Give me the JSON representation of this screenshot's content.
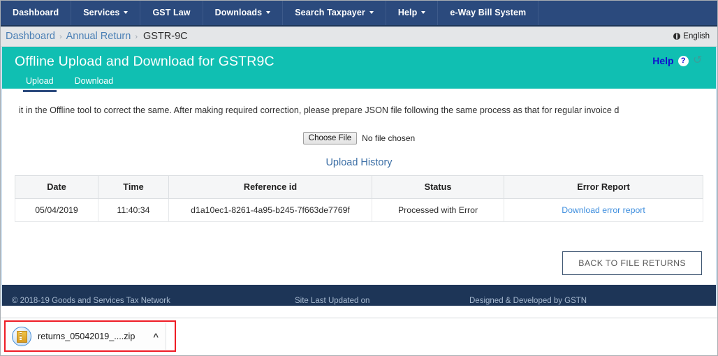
{
  "navbar": {
    "items": [
      {
        "label": "Dashboard",
        "has_caret": false
      },
      {
        "label": "Services",
        "has_caret": true
      },
      {
        "label": "GST Law",
        "has_caret": false
      },
      {
        "label": "Downloads",
        "has_caret": true
      },
      {
        "label": "Search Taxpayer",
        "has_caret": true
      },
      {
        "label": "Help",
        "has_caret": true
      },
      {
        "label": "e-Way Bill System",
        "has_caret": false
      }
    ]
  },
  "breadcrumb": {
    "items": [
      "Dashboard",
      "Annual Return",
      "GSTR-9C"
    ],
    "separator": "›",
    "language": "English",
    "language_icon": "globe-icon"
  },
  "page_header": {
    "title": "Offline Upload and Download for GSTR9C",
    "help_label": "Help",
    "help_badge": "?",
    "refresh_icon": "refresh-icon",
    "tabs": [
      {
        "label": "Upload",
        "active": true
      },
      {
        "label": "Download",
        "active": false
      }
    ]
  },
  "content": {
    "note": "it in the Offline tool to correct the same. After making required correction, please prepare JSON file following the same process as that for regular invoice d",
    "choose_file_label": "Choose File",
    "no_file_label": "No file chosen",
    "upload_history_title": "Upload History"
  },
  "history_table": {
    "headers": [
      "Date",
      "Time",
      "Reference id",
      "Status",
      "Error Report"
    ],
    "rows": [
      {
        "date": "05/04/2019",
        "time": "11:40:34",
        "reference_id": "d1a10ec1-8261-4a95-b245-7f663de7769f",
        "status": "Processed with Error",
        "error_report": "Download error report"
      }
    ]
  },
  "actions": {
    "back_label": "BACK TO FILE RETURNS"
  },
  "footer": {
    "copyright": "© 2018-19 Goods and Services Tax Network",
    "site_updated": "Site Last Updated on",
    "developed_by": "Designed & Developed by GSTN"
  },
  "download_bar": {
    "file_name": "returns_05042019_....zip",
    "file_icon": "zip-file-icon",
    "chevron": "⌃"
  },
  "colors": {
    "nav_bg": "#2b4a7d",
    "teal": "#10bfb2",
    "footer_bg": "#1d3557",
    "link_blue": "#3e8ede",
    "help_blue": "#0f0fd0",
    "highlight_red": "#ee1c25"
  }
}
